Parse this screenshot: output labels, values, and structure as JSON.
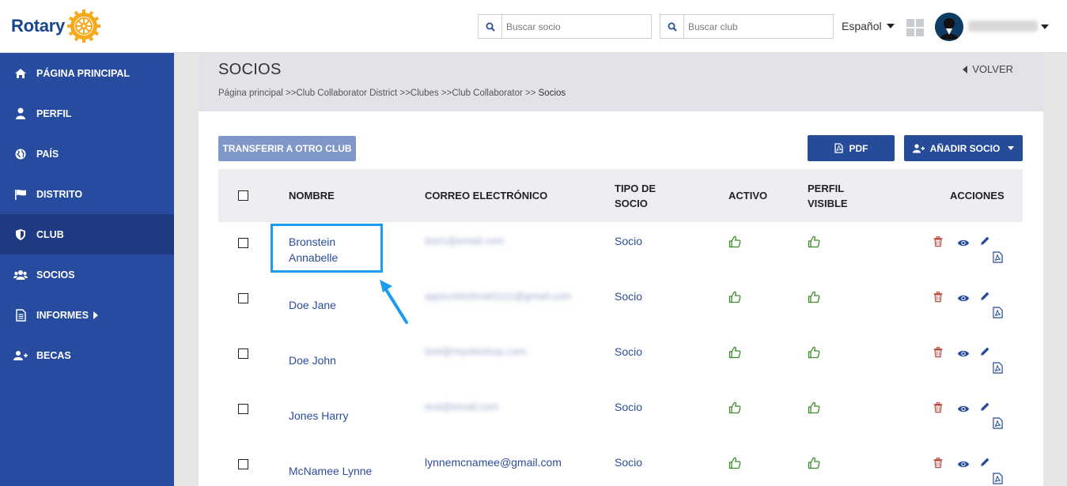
{
  "header": {
    "logo_text": "Rotary",
    "search_member_placeholder": "Buscar socio",
    "search_club_placeholder": "Buscar club",
    "language": "Español",
    "icons": [
      "search-icon",
      "apps-grid-icon",
      "avatar",
      "chevron-down-icon"
    ]
  },
  "sidebar": {
    "items": [
      {
        "label": "PÁGINA PRINCIPAL",
        "icon": "home-icon"
      },
      {
        "label": "PERFIL",
        "icon": "user-icon"
      },
      {
        "label": "PAÍS",
        "icon": "globe-icon"
      },
      {
        "label": "DISTRITO",
        "icon": "flag-icon"
      },
      {
        "label": "CLUB",
        "icon": "shield-icon",
        "active": true
      },
      {
        "label": "SOCIOS",
        "icon": "users-icon"
      },
      {
        "label": "INFORMES",
        "icon": "document-icon"
      },
      {
        "label": "BECAS",
        "icon": "user-plus-icon"
      }
    ]
  },
  "page": {
    "title": "SOCIOS",
    "breadcrumb": "Página principal >>Club Collaborator District >>Clubes >>Club Collaborator >> ",
    "breadcrumb_current": "Socios",
    "back_label": "VOLVER"
  },
  "toolbar": {
    "transfer_label": "TRANSFERIR A OTRO CLUB",
    "pdf_label": "PDF",
    "add_label": "AÑADIR SOCIO"
  },
  "table": {
    "headers": {
      "name": "NOMBRE",
      "email": "CORREO ELECTRÓNICO",
      "type_line1": "TIPO DE",
      "type_line2": "SOCIO",
      "active": "ACTIVO",
      "visible_line1": "PERFIL",
      "visible_line2": "VISIBLE",
      "actions": "ACCIONES"
    },
    "rows": [
      {
        "name_line1": "Bronstein",
        "name_line2": "Annabelle",
        "email": "test1@email.com",
        "email_blurred": true,
        "type": "Socio"
      },
      {
        "name_line1": "Doe Jane",
        "name_line2": "",
        "email": "appscotestmail1111@gmail.com",
        "email_blurred": true,
        "type": "Socio"
      },
      {
        "name_line1": "Doe John",
        "name_line2": "",
        "email": "test@mysiteshop.com",
        "email_blurred": true,
        "type": "Socio"
      },
      {
        "name_line1": "Jones Harry",
        "name_line2": "",
        "email": "test@email.com",
        "email_blurred": true,
        "type": "Socio"
      },
      {
        "name_line1": "McNamee Lynne",
        "name_line2": "",
        "email": "lynnemcnamee@gmail.com",
        "email_blurred": false,
        "type": "Socio"
      }
    ]
  },
  "colors": {
    "brand_blue": "#17458f",
    "sidebar": "#274b9f",
    "sidebar_active": "#1d3a82",
    "link": "#2c4d98",
    "thumb_green": "#3a8a2a",
    "trash_red": "#b84a3a",
    "highlight": "#1b9cf2"
  }
}
